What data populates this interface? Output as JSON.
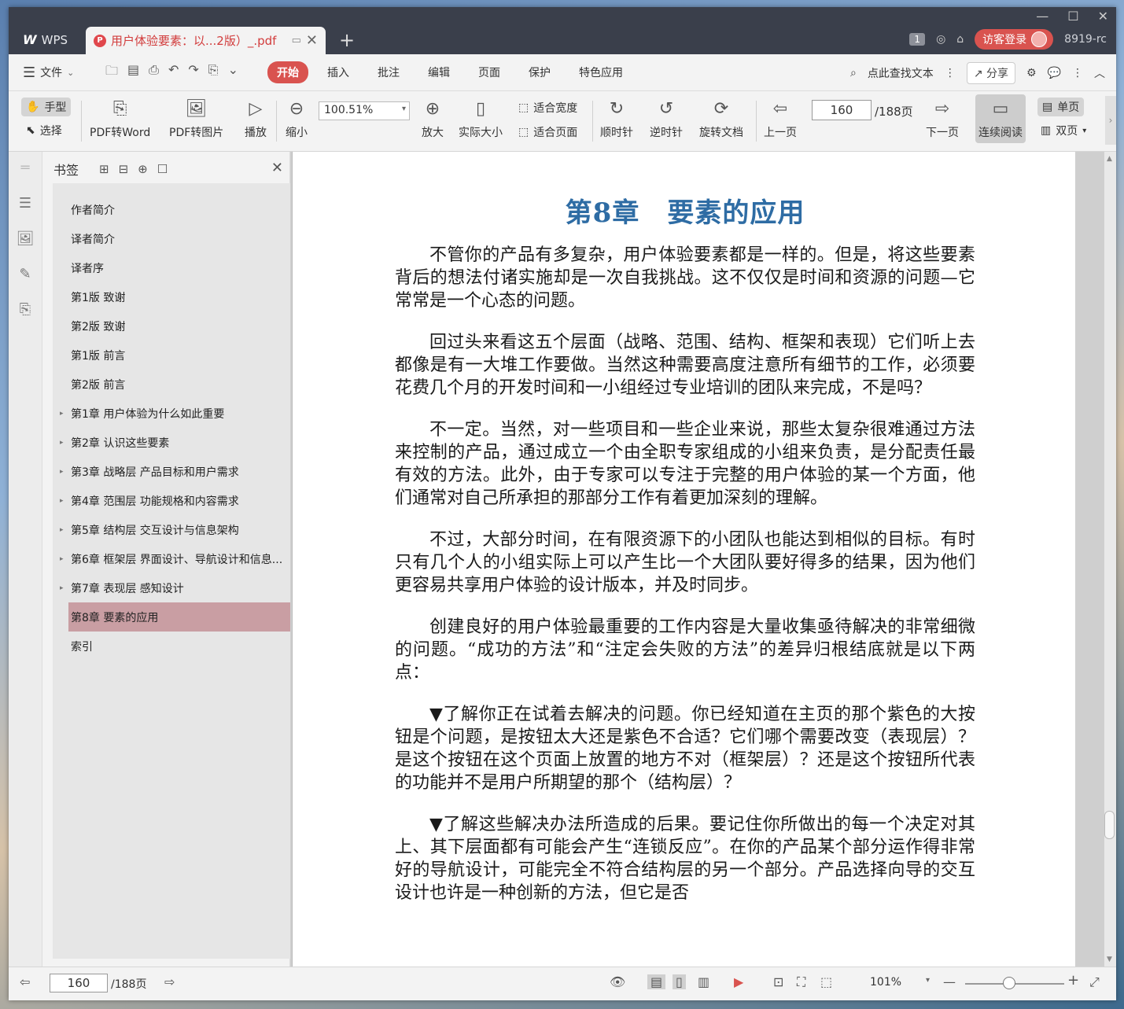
{
  "tabbar": {
    "app_label": "WPS",
    "doc_title": "用户体验要素：以...2版）_.pdf",
    "page_badge": "1",
    "login_label": "访客登录",
    "user_id": "8919-rc"
  },
  "menubar": {
    "file_label": "文件",
    "tabs": [
      "开始",
      "插入",
      "批注",
      "编辑",
      "页面",
      "保护",
      "特色应用"
    ],
    "active_tab": "开始",
    "search_label": "点此查找文本",
    "share_label": "分享"
  },
  "toolbar": {
    "hand": "手型",
    "select": "选择",
    "pdf_word": "PDF转Word",
    "pdf_img": "PDF转图片",
    "play": "播放",
    "zoom_out": "缩小",
    "zoom_value": "100.51%",
    "zoom_in": "放大",
    "actual_size": "实际大小",
    "fit_width": "适合宽度",
    "fit_page": "适合页面",
    "clockwise": "顺时针",
    "counter": "逆时针",
    "rotate_doc": "旋转文档",
    "prev_page": "上一页",
    "page_value": "160",
    "page_total": "/188页",
    "next_page": "下一页",
    "continuous": "连续阅读",
    "single": "单页",
    "double": "双页"
  },
  "panel": {
    "title": "书签",
    "items": [
      {
        "label": "作者简介",
        "expandable": false
      },
      {
        "label": "译者简介",
        "expandable": false
      },
      {
        "label": "译者序",
        "expandable": false
      },
      {
        "label": "第1版 致谢",
        "expandable": false
      },
      {
        "label": "第2版 致谢",
        "expandable": false
      },
      {
        "label": "第1版 前言",
        "expandable": false
      },
      {
        "label": "第2版 前言",
        "expandable": false
      },
      {
        "label": "第1章 用户体验为什么如此重要",
        "expandable": true
      },
      {
        "label": "第2章 认识这些要素",
        "expandable": true
      },
      {
        "label": "第3章 战略层 产品目标和用户需求",
        "expandable": true
      },
      {
        "label": "第4章 范围层 功能规格和内容需求",
        "expandable": true
      },
      {
        "label": "第5章 结构层 交互设计与信息架构",
        "expandable": true
      },
      {
        "label": "第6章 框架层 界面设计、导航设计和信息...",
        "expandable": true
      },
      {
        "label": "第7章 表现层 感知设计",
        "expandable": true
      },
      {
        "label": "第8章 要素的应用",
        "expandable": true,
        "selected": true
      },
      {
        "label": "索引",
        "expandable": false
      }
    ]
  },
  "document": {
    "chapter_title": "第8章　要素的应用",
    "paragraphs": [
      "不管你的产品有多复杂，用户体验要素都是一样的。但是，将这些要素背后的想法付诸实施却是一次自我挑战。这不仅仅是时间和资源的问题—它常常是一个心态的问题。",
      "回过头来看这五个层面（战略、范围、结构、框架和表现）它们听上去都像是有一大堆工作要做。当然这种需要高度注意所有细节的工作，必须要花费几个月的开发时间和一小组经过专业培训的团队来完成，不是吗？",
      "不一定。当然，对一些项目和一些企业来说，那些太复杂很难通过方法来控制的产品，通过成立一个由全职专家组成的小组来负责，是分配责任最有效的方法。此外，由于专家可以专注于完整的用户体验的某一个方面，他们通常对自己所承担的那部分工作有着更加深刻的理解。",
      "不过，大部分时间，在有限资源下的小团队也能达到相似的目标。有时只有几个人的小组实际上可以产生比一个大团队要好得多的结果，因为他们更容易共享用户体验的设计版本，并及时同步。",
      "创建良好的用户体验最重要的工作内容是大量收集亟待解决的非常细微的问题。“成功的方法”和“注定会失败的方法”的差异归根结底就是以下两点：",
      "▼了解你正在试着去解决的问题。你已经知道在主页的那个紫色的大按钮是个问题，是按钮太大还是紫色不合适？它们哪个需要改变（表现层）？是这个按钮在这个页面上放置的地方不对（框架层）？还是这个按钮所代表的功能并不是用户所期望的那个（结构层）？",
      "▼了解这些解决办法所造成的后果。要记住你所做出的每一个决定对其上、其下层面都有可能会产生“连锁反应”。在你的产品某个部分运作得非常好的导航设计，可能完全不符合结构层的另一个部分。产品选择向导的交互设计也许是一种创新的方法，但它是否"
    ]
  },
  "statusbar": {
    "page_value": "160",
    "page_total": "/188页",
    "zoom_label": "101%"
  },
  "colors": {
    "accent": "#d9534f",
    "title_blue": "#2e6ca4",
    "bookmark_selected": "#c99ea3"
  }
}
